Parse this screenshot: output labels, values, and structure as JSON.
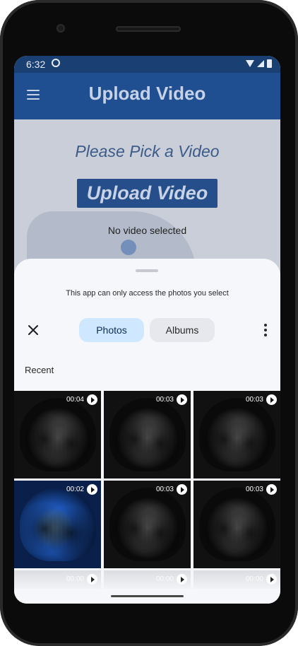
{
  "status": {
    "time": "6:32"
  },
  "app": {
    "title": "Upload Video"
  },
  "main": {
    "pick_title": "Please Pick a Video",
    "upload_button": "Upload Video",
    "selection_status": "No video selected"
  },
  "picker": {
    "access_note": "This app can only access the photos you select",
    "tabs": [
      {
        "label": "Photos"
      },
      {
        "label": "Albums"
      }
    ],
    "section_label": "Recent",
    "items": [
      {
        "duration": "00:04"
      },
      {
        "duration": "00:03"
      },
      {
        "duration": "00:03"
      },
      {
        "duration": "00:02"
      },
      {
        "duration": "00:03"
      },
      {
        "duration": "00:03"
      },
      {
        "duration": "00:00"
      },
      {
        "duration": "00:00"
      },
      {
        "duration": "00:00"
      }
    ]
  }
}
